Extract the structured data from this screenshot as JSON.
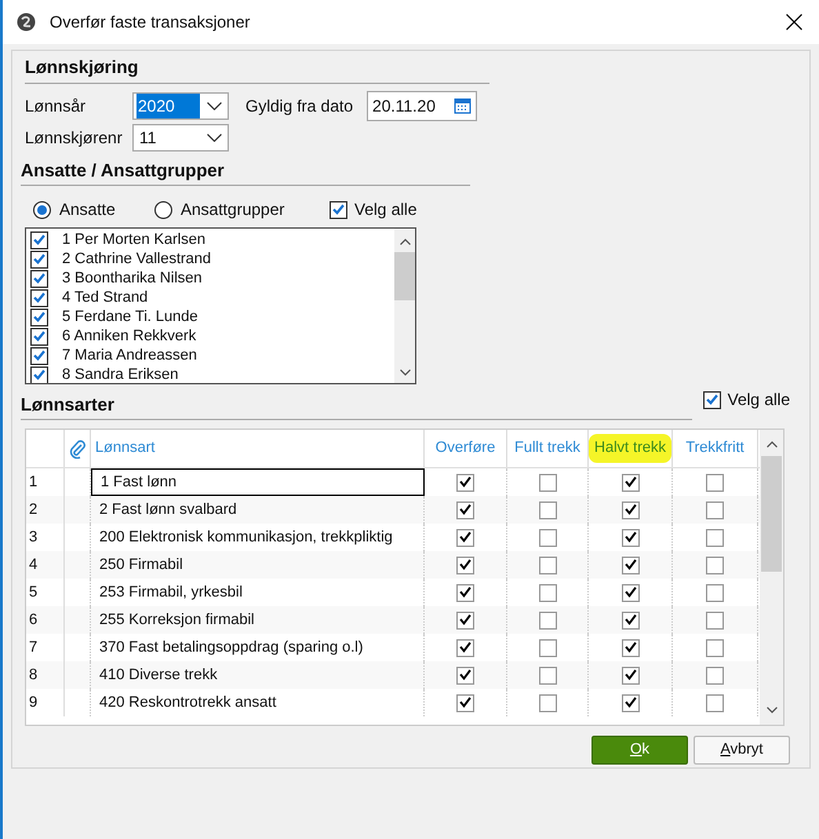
{
  "window": {
    "title": "Overfør faste transaksjoner"
  },
  "lonnskjoring": {
    "heading": "Lønnskjøring",
    "year_label": "Lønnsår",
    "year_value": "2020",
    "date_label": "Gyldig fra dato",
    "date_value": "20.11.20",
    "run_label": "Lønnskjørenr",
    "run_value": "11"
  },
  "ansatte": {
    "heading": "Ansatte / Ansattgrupper",
    "options": [
      {
        "label": "Ansatte",
        "selected": true
      },
      {
        "label": "Ansattgrupper",
        "selected": false
      }
    ],
    "select_all": {
      "label": "Velg alle",
      "checked": true
    },
    "employees": [
      {
        "name": "1 Per Morten Karlsen",
        "checked": true
      },
      {
        "name": "2 Cathrine Vallestrand",
        "checked": true
      },
      {
        "name": "3 Boontharika Nilsen",
        "checked": true
      },
      {
        "name": "4 Ted Strand",
        "checked": true
      },
      {
        "name": "5 Ferdane Ti. Lunde",
        "checked": true
      },
      {
        "name": "6 Anniken Rekkverk",
        "checked": true
      },
      {
        "name": "7 Maria Andreassen",
        "checked": true
      },
      {
        "name": "8 Sandra Eriksen",
        "checked": true
      }
    ]
  },
  "lonnsarter": {
    "heading": "Lønnsarter",
    "select_all": {
      "label": "Velg alle",
      "checked": true
    },
    "columns": [
      {
        "label": "Lønnsart",
        "highlighted": false
      },
      {
        "label": "Overføre",
        "highlighted": false
      },
      {
        "label": "Fullt trekk",
        "highlighted": false
      },
      {
        "label": "Halvt trekk",
        "highlighted": true
      },
      {
        "label": "Trekkfritt",
        "highlighted": false
      }
    ],
    "rows": [
      {
        "num": "1",
        "name": "1 Fast lønn",
        "selected": true,
        "checks": [
          true,
          false,
          true,
          false
        ]
      },
      {
        "num": "2",
        "name": "2 Fast lønn svalbard",
        "selected": false,
        "checks": [
          true,
          false,
          true,
          false
        ]
      },
      {
        "num": "3",
        "name": "200 Elektronisk kommunikasjon, trekkpliktig",
        "selected": false,
        "checks": [
          true,
          false,
          true,
          false
        ]
      },
      {
        "num": "4",
        "name": "250 Firmabil",
        "selected": false,
        "checks": [
          true,
          false,
          true,
          false
        ]
      },
      {
        "num": "5",
        "name": "253 Firmabil, yrkesbil",
        "selected": false,
        "checks": [
          true,
          false,
          true,
          false
        ]
      },
      {
        "num": "6",
        "name": "255 Korreksjon firmabil",
        "selected": false,
        "checks": [
          true,
          false,
          true,
          false
        ]
      },
      {
        "num": "7",
        "name": "370 Fast betalingsoppdrag (sparing o.l)",
        "selected": false,
        "checks": [
          true,
          false,
          true,
          false
        ]
      },
      {
        "num": "8",
        "name": "410 Diverse trekk",
        "selected": false,
        "checks": [
          true,
          false,
          true,
          false
        ]
      },
      {
        "num": "9",
        "name": "420 Reskontrotrekk ansatt",
        "selected": false,
        "checks": [
          true,
          false,
          true,
          false
        ]
      }
    ]
  },
  "buttons": [
    {
      "label": "Ok",
      "kind": "primary"
    },
    {
      "label": "Avbryt",
      "kind": "secondary"
    }
  ]
}
